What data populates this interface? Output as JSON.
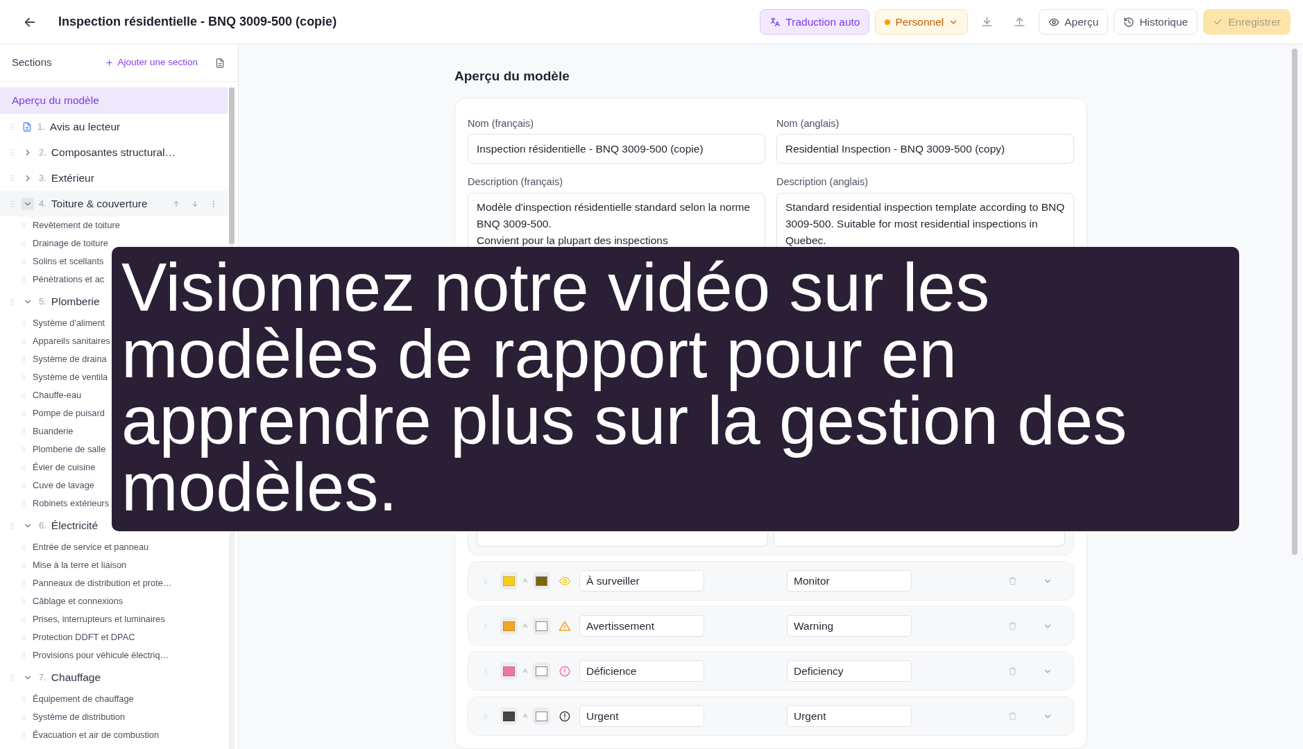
{
  "header": {
    "title": "Inspection résidentielle - BNQ 3009-500 (copie)",
    "buttons": [
      {
        "kind": "translate",
        "label": "Traduction auto"
      },
      {
        "kind": "workspace",
        "label": "Personnel"
      },
      {
        "kind": "download"
      },
      {
        "kind": "upload"
      },
      {
        "kind": "preview",
        "label": "Aperçu"
      },
      {
        "kind": "history",
        "label": "Historique"
      },
      {
        "kind": "save",
        "label": "Enregistrer",
        "disabled": true
      }
    ]
  },
  "sidebar": {
    "title": "Sections",
    "add_label": "Ajouter une section",
    "overview": {
      "label": "Aperçu du modèle",
      "selected": true
    },
    "sections": [
      {
        "kind": "document",
        "number": "1.",
        "label": "Avis au lecteur",
        "hovered": false
      },
      {
        "kind": "folder",
        "number": "2.",
        "label": "Composantes structural…",
        "expanded": false,
        "hovered": false
      },
      {
        "kind": "folder",
        "number": "3.",
        "label": "Extérieur",
        "expanded": false,
        "hovered": false
      },
      {
        "kind": "folder",
        "number": "4.",
        "label": "Toiture & couverture",
        "expanded": true,
        "hovered": true,
        "children": [
          "Revêtement de toiture",
          "Drainage de toiture",
          "Solins et scellants",
          "Pénétrations et ac"
        ]
      },
      {
        "kind": "folder",
        "number": "5.",
        "label": "Plomberie",
        "expanded": true,
        "hovered": false,
        "children": [
          "Système d'aliment",
          "Appareils sanitaires",
          "Système de draina",
          "Système de ventila",
          "Chauffe-eau",
          "Pompe de puisard",
          "Buanderie",
          "Plomberie de salle",
          "Évier de cuisine",
          "Cuve de lavage",
          "Robinets extérieurs"
        ]
      },
      {
        "kind": "folder",
        "number": "6.",
        "label": "Électricité",
        "expanded": true,
        "hovered": false,
        "children": [
          "Entrée de service et panneau",
          "Mise à la terre et liaison",
          "Panneaux de distribution et prote…",
          "Câblage et connexions",
          "Prises, interrupteurs et luminaires",
          "Protection DDFT et DPAC",
          "Provisions pour véhicule électriq…"
        ]
      },
      {
        "kind": "folder",
        "number": "7.",
        "label": "Chauffage",
        "expanded": true,
        "hovered": false,
        "children": [
          "Équipement de chauffage",
          "Système de distribution",
          "Évacuation et air de combustion"
        ]
      }
    ]
  },
  "overview": {
    "heading": "Aperçu du modèle",
    "names": [
      {
        "label": "Nom (français)",
        "value": "Inspection résidentielle - BNQ 3009-500 (copie)"
      },
      {
        "label": "Nom (anglais)",
        "value": "Residential Inspection - BNQ 3009-500 (copy)"
      }
    ],
    "descriptions": [
      {
        "label": "Description (français)",
        "value": "Modèle d'inspection résidentielle standard selon la norme BNQ 3009-500.\nConvient pour la plupart des inspections"
      },
      {
        "label": "Description (anglais)",
        "value": "Standard residential inspection template according to BNQ 3009-500. Suitable for most residential inspections in Quebec."
      }
    ],
    "statuses": [
      {
        "kind": "eye",
        "color": "#facc15",
        "text_style": {
          "color": "#7a6500"
        },
        "text_marker": "A",
        "label_fr": "À surveiller",
        "label_en": "Monitor"
      },
      {
        "kind": "warning",
        "color": "#f5a524",
        "text_style": {
          "color": "#ffffff"
        },
        "text_marker": "A",
        "label_fr": "Avertissement",
        "label_en": "Warning"
      },
      {
        "kind": "alert",
        "color": "#ef75a0",
        "text_style": {
          "color": "#ffffff"
        },
        "text_marker": "A",
        "label_fr": "Déficience",
        "label_en": "Deficiency"
      },
      {
        "kind": "alert",
        "color": "#454545",
        "text_style": {
          "color": "#ffffff"
        },
        "text_marker": "A",
        "label_fr": "Urgent",
        "label_en": "Urgent"
      }
    ]
  },
  "overlay": {
    "text": "Visionnez notre vidéo sur les modèles de rapport pour en apprendre plus sur la gestion des modèles."
  }
}
